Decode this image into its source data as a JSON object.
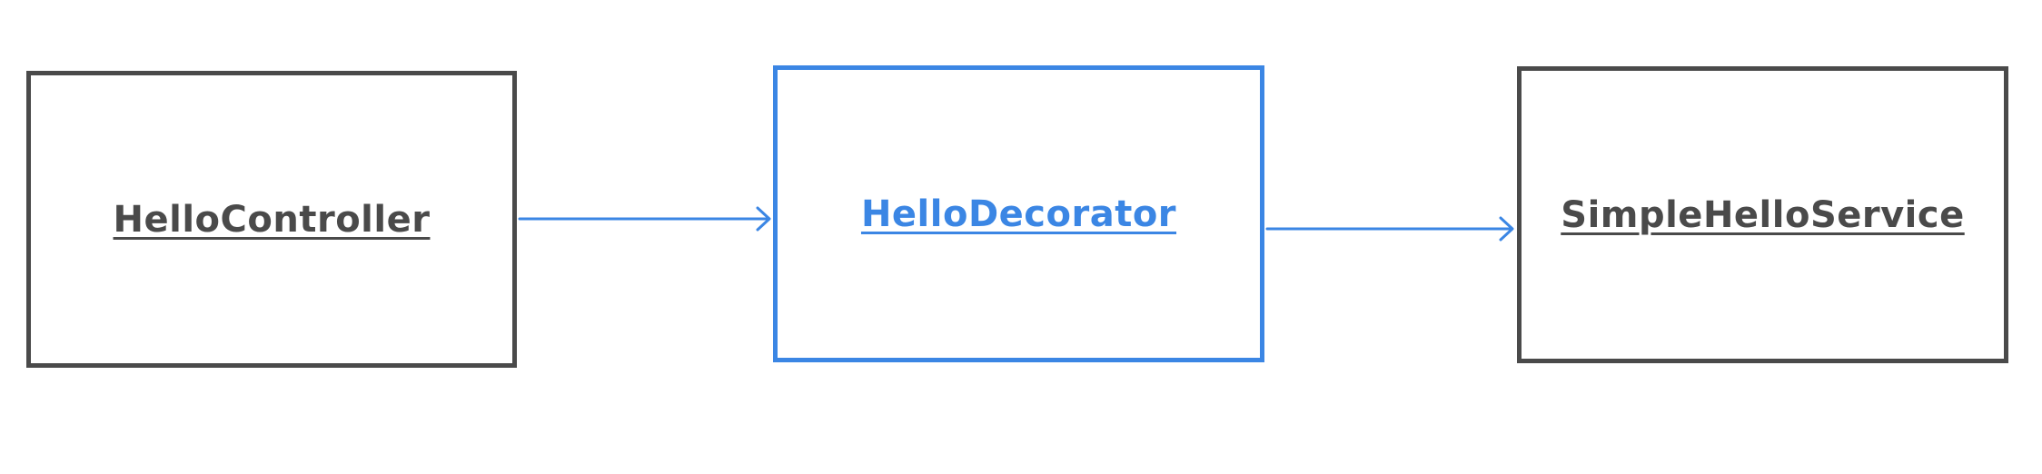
{
  "diagram": {
    "nodes": [
      {
        "id": "controller",
        "label": "HelloController",
        "color": "#4a4a4a"
      },
      {
        "id": "decorator",
        "label": "HelloDecorator",
        "color": "#3b86e4"
      },
      {
        "id": "service",
        "label": "SimpleHelloService",
        "color": "#4a4a4a"
      }
    ],
    "edges": [
      {
        "from": "HelloController",
        "to": "HelloDecorator",
        "color": "#3b86e4"
      },
      {
        "from": "HelloDecorator",
        "to": "SimpleHelloService",
        "color": "#3b86e4"
      }
    ]
  }
}
